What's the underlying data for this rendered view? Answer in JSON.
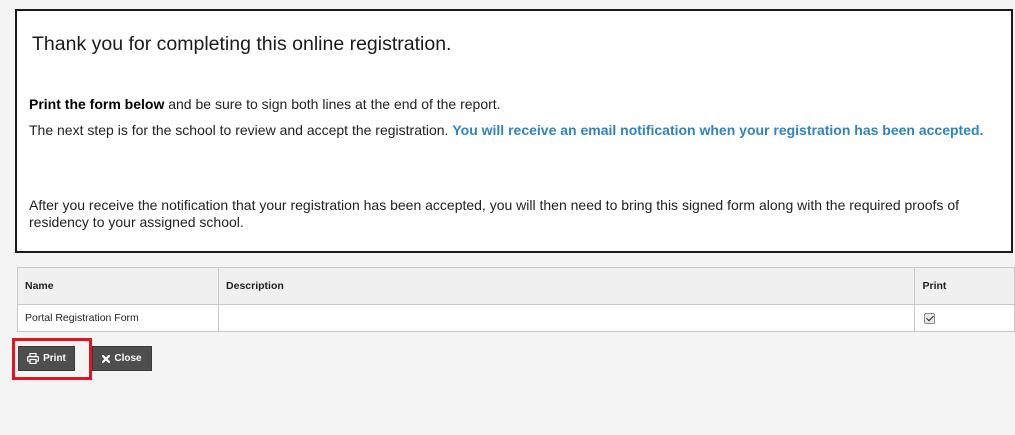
{
  "notice": {
    "heading": "Thank you for completing this online registration.",
    "p1_bold": "Print the form below",
    "p1_rest": " and be sure to sign both lines at the end of the report.",
    "p2_text": "The next step is for the school to review and accept the registration. ",
    "p2_highlight": "You will receive an email notification when your registration has been accepted.",
    "p3_text": "After you receive the notification that your registration has been accepted, you will then need to bring this signed form along with the required proofs of residency to your assigned school."
  },
  "table": {
    "headers": {
      "name": "Name",
      "description": "Description",
      "print": "Print"
    },
    "rows": [
      {
        "name": "Portal Registration Form",
        "description": "",
        "print": true
      }
    ]
  },
  "buttons": {
    "print_label": "Print",
    "close_label": "Close"
  },
  "colors": {
    "highlight_text": "#2f84bd",
    "button_bg": "#4e4e4e",
    "annotation_box": "#e5121f"
  },
  "icons": {
    "print": "printer-icon",
    "close": "close-x-icon"
  }
}
